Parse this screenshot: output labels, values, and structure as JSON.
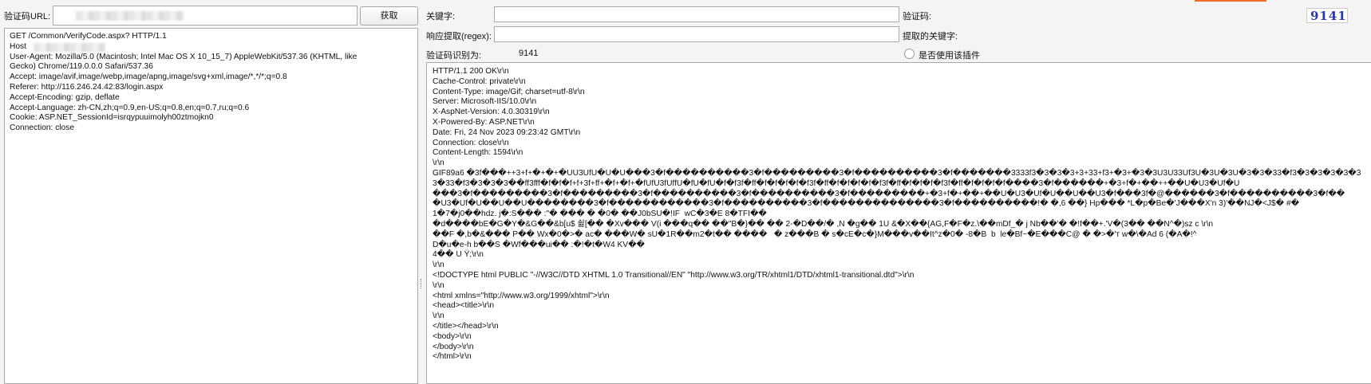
{
  "left": {
    "url_label": "验证码URL:",
    "fetch_button": "获取",
    "request_text": "GET /Common/VerifyCode.aspx? HTTP/1.1\nHost\nUser-Agent: Mozilla/5.0 (Macintosh; Intel Mac OS X 10_15_7) AppleWebKit/537.36 (KHTML, like\nGecko) Chrome/119.0.0.0 Safari/537.36\nAccept: image/avif,image/webp,image/apng,image/svg+xml,image/*,*/*;q=0.8\nReferer: http://116.246.24.42:83/login.aspx\nAccept-Encoding: gzip, deflate\nAccept-Language: zh-CN,zh;q=0.9,en-US;q=0.8,en;q=0.7,ru;q=0.6\nCookie: ASP.NET_SessionId=isrqypuuimolyh00ztmojkn0\nConnection: close"
  },
  "right": {
    "keyword_label": "关键字:",
    "captcha_label": "验证码:",
    "captcha_image_text": "9141",
    "regex_label": "响应提取(regex):",
    "extracted_keyword_label": "提取的关键字:",
    "recognized_label": "验证码识别为:",
    "recognized_value": "9141",
    "use_plugin_label": "是否使用该插件",
    "response_text": "HTTP/1.1 200 OK\\r\\n\nCache-Control: private\\r\\n\nContent-Type: image/Gif; charset=utf-8\\r\\n\nServer: Microsoft-IIS/10.0\\r\\n\nX-AspNet-Version: 4.0.30319\\r\\n\nX-Powered-By: ASP.NET\\r\\n\nDate: Fri, 24 Nov 2023 09:23:42 GMT\\r\\n\nConnection: close\\r\\n\nContent-Length: 1594\\r\\n\n\\r\\n\nGIF89a6 �3f���++3+f+�+�+�UU3UfU�U�U���3�f����������3�f���������3�f����������3�f�������3333f3�3�3�3+3+33+f3+�3+�3�3U3U33Uf3U�3U�3U�3�3�33�f3�3�3�3�3�3\n3�33�f3�3�3�3��ff3fff�f�f�f+f+3f+ff+�f+�f+�fUfU3fUffU�fU�fU�f�f3f�ff�f�f�f�f�f3f�ff�f�f�f�f�f3f�ff�f�f�f�f3f�ff�f�f�f�f����3�f������+�3+f�+��++��U�U3�Uf�U\n���3�f���������3�f���������3�f����������3�f����������3�f���������+�3+f�+��+��U�U3�Uf�U��U��U3�f���3f�@������3�f����������3�f��\n�U3�Uf�U��U��U��������3�f������������3�f����������3�f��������������3�f����������!� �,6 ��} Hp��� *L�p�Be�'J���X'n 3)'��NJ�<J$� #�\n1�7�j0��hdz. j�:S��� :\"� ��� � �0� ��J0bSU�!IF  wC�3�E 8�TFI��\n�d����bE�G�Y�&G��&b[u$ 쇯[�� �Xv��� V(i ���q�� ��\"B�}�� �� 2-�D��/� ,N �g�� 1U &�X��{AG,F�F�z.\\��mDf_� j Nb��'� �!f��+.'V�(3�� ��N^�)sz c \\r\\n\n��F �,b�&��� P�� Wx�0�>� ac� ���W� sU�1R��m2�t�� ����   � z���B � s�cE�c�}M���v��It^z�0� -8�B  b  le�Bf~�E���C@ � �>�'т w�\\�Ad 6 (�A�!^\nD�u�e-h b��S �Wf���ui�� :�!�t�W4 KV��\n4�� U Ÿ;\\r\\n\n\\r\\n\n<!DOCTYPE html PUBLIC \"-//W3C//DTD XHTML 1.0 Transitional//EN\" \"http://www.w3.org/TR/xhtml1/DTD/xhtml1-transitional.dtd\">\\r\\n\n\\r\\n\n<html xmlns=\"http://www.w3.org/1999/xhtml\">\\r\\n\n<head><title>\\r\\n\n\\r\\n\n</title></head>\\r\\n\n<body>\\r\\n\n</body>\\r\\n\n</html>\\r\\n"
  },
  "colors": {
    "captcha_text": "#2a3a9c",
    "top_accent": "#f26b2a"
  }
}
